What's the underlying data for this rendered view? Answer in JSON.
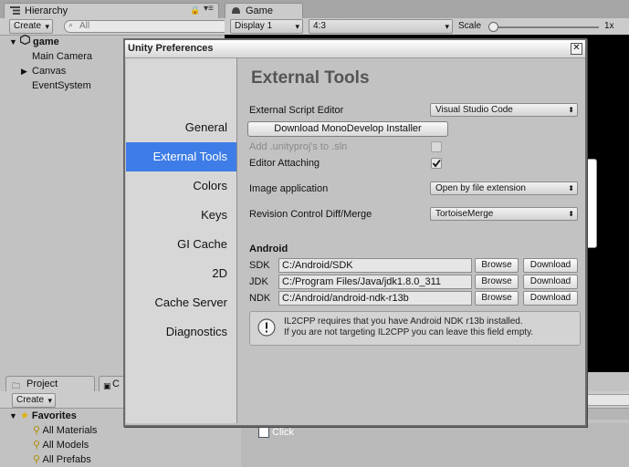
{
  "editor": {
    "hierarchy_tab": "Hierarchy",
    "game_tab": "Game",
    "create_label": "Create",
    "search_placeholder": "All",
    "display_select": "Display 1",
    "aspect_select": "4:3",
    "scale_label": "Scale",
    "scale_value": "1x",
    "scene_name": "game",
    "hierarchy_items": [
      "Main Camera",
      "Canvas",
      "EventSystem"
    ],
    "project_tab": "Project",
    "console_tab_partial": "C",
    "project_create": "Create",
    "favorites_label": "Favorites",
    "favorites_items": [
      "All Materials",
      "All Models",
      "All Prefabs"
    ],
    "asset_item": "Click"
  },
  "dialog": {
    "title": "Unity Preferences",
    "close_label": "✕",
    "sidebar": [
      {
        "label": "General",
        "selected": false
      },
      {
        "label": "External Tools",
        "selected": true
      },
      {
        "label": "Colors",
        "selected": false
      },
      {
        "label": "Keys",
        "selected": false
      },
      {
        "label": "GI Cache",
        "selected": false
      },
      {
        "label": "2D",
        "selected": false
      },
      {
        "label": "Cache Server",
        "selected": false
      },
      {
        "label": "Diagnostics",
        "selected": false
      }
    ],
    "content_title": "External Tools",
    "script_editor_label": "External Script Editor",
    "script_editor_value": "Visual Studio Code",
    "download_mono_button": "Download MonoDevelop Installer",
    "add_unityproj_label": "Add .unityproj's to .sln",
    "add_unityproj_checked": false,
    "editor_attaching_label": "Editor Attaching",
    "editor_attaching_checked": true,
    "image_app_label": "Image application",
    "image_app_value": "Open by file extension",
    "revision_label": "Revision Control Diff/Merge",
    "revision_value": "TortoiseMerge",
    "android_heading": "Android",
    "android_rows": [
      {
        "label": "SDK",
        "path": "C:/Android/SDK"
      },
      {
        "label": "JDK",
        "path": "C:/Program Files/Java/jdk1.8.0_311"
      },
      {
        "label": "NDK",
        "path": "C:/Android/android-ndk-r13b"
      }
    ],
    "browse_label": "Browse",
    "download_label": "Download",
    "help_line1": "IL2CPP requires that you have Android NDK r13b installed.",
    "help_line2": "If you are not targeting IL2CPP you can leave this field empty.",
    "accent_color": "#3e7de7"
  }
}
